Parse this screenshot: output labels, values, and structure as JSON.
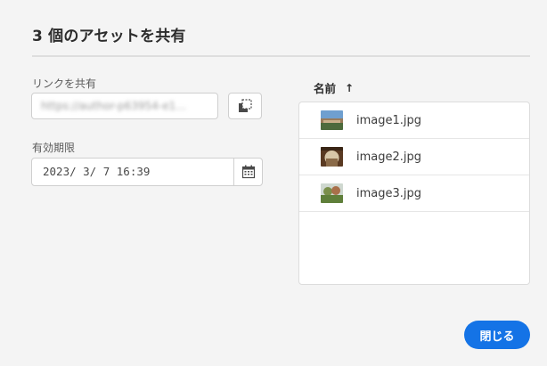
{
  "dialog": {
    "title": "3 個のアセットを共有",
    "link_label": "リンクを共有",
    "link_value": "https://author-p63954-e1…",
    "expiration_label": "有効期限",
    "expiration_value": "2023/ 3/ 7 16:39",
    "copy_icon": "copy-icon",
    "calendar_icon": "calendar-icon",
    "close_button": "閉じる",
    "accent_color": "#1473e6"
  },
  "file_list": {
    "header": "名前",
    "sort_icon": "↑",
    "files": [
      {
        "name": "image1.jpg",
        "thumb_icon": "landscape-thumbnail"
      },
      {
        "name": "image2.jpg",
        "thumb_icon": "interior-thumbnail"
      },
      {
        "name": "image3.jpg",
        "thumb_icon": "garden-thumbnail"
      }
    ]
  }
}
